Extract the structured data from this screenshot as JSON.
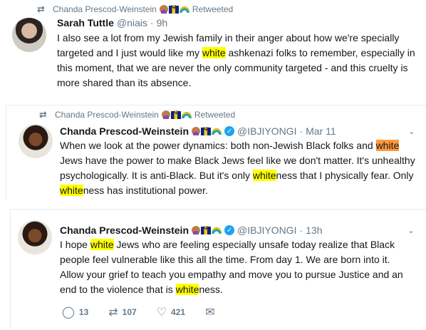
{
  "tweets": [
    {
      "retweeted_by": "Chanda Prescod-Weinstein",
      "retweeted_label": "Retweeted",
      "name": "Sarah Tuttle",
      "handle": "@niais",
      "dot": "·",
      "time": "9h",
      "text_segments": [
        "I also see a lot from my Jewish family in their anger about how we're specially targeted and I just would like my ",
        "white",
        " ashkenazi folks to remember, especially in this moment, that we are never the only community targeted - and this cruelty is more shared than its absence."
      ]
    },
    {
      "retweeted_by": "Chanda Prescod-Weinstein",
      "retweeted_label": "Retweeted",
      "name": "Chanda Prescod-Weinstein",
      "handle": "@IBJIYONGI",
      "dot": "·",
      "time": "Mar 11",
      "text_segments": [
        "When we look at the power dynamics: both non-Jewish Black folks and ",
        "white",
        " Jews have the power to make Black Jews feel like we don't matter. It's unhealthy psychologically. It is anti-Black. But it's only ",
        "white",
        "ness that I physically fear. Only ",
        "white",
        "ness has institutional power."
      ]
    },
    {
      "name": "Chanda Prescod-Weinstein",
      "handle": "@IBJIYONGI",
      "dot": "·",
      "time": "13h",
      "text_segments": [
        "I hope ",
        "white",
        " Jews who are feeling especially unsafe today realize that Black people feel vulnerable like this all the time. From day 1. We are born into it. Allow your grief to teach you empathy and move you to pursue Justice and an end to the violence that is ",
        "white",
        "ness."
      ],
      "actions": {
        "reply_count": "13",
        "retweet_count": "107",
        "like_count": "421"
      }
    }
  ],
  "icons": {
    "retweet": "retweet-icon",
    "reply": "reply-icon",
    "like": "heart-icon",
    "message": "envelope-icon",
    "caret": "chevron-down-icon",
    "verified": "verified-badge-icon"
  },
  "colors": {
    "highlight_yellow": "#ffff00",
    "highlight_orange": "#ff9a3c",
    "verified_blue": "#1da1f2",
    "muted_text": "#657786"
  }
}
